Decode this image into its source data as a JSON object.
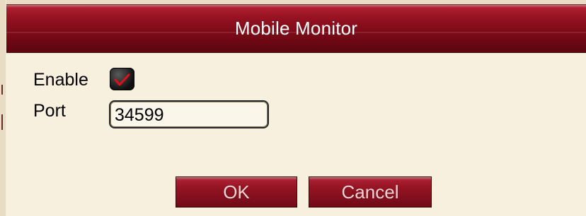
{
  "dialog": {
    "title": "Mobile Monitor"
  },
  "form": {
    "enable_label": "Enable",
    "enable_checked": true,
    "port_label": "Port",
    "port_value": "34599"
  },
  "buttons": {
    "ok_label": "OK",
    "cancel_label": "Cancel"
  },
  "colors": {
    "titlebar": "#8a0e1c",
    "background": "#f8f0de",
    "checkmark": "#e0101a",
    "button_text": "#ffd6d6"
  }
}
